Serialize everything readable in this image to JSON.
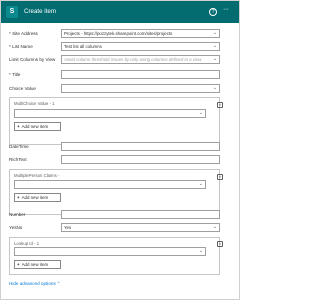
{
  "header": {
    "app_icon": "sharepoint-icon",
    "app_letter": "S",
    "title": "Create item",
    "help_glyph": "?",
    "more_glyph": "···"
  },
  "fields": {
    "site_address": {
      "label": "* Site Address",
      "value": "Projects - https://pozzytek.sharepoint.com/sites/projects"
    },
    "list_name": {
      "label": "* List Name",
      "value": "Test list all columns"
    },
    "limit_columns": {
      "label": "Limit Columns by View",
      "placeholder": "Avoid column threshold issues by only using columns defined in a view"
    },
    "title": {
      "label": "* Title",
      "value": ""
    },
    "choice_value": {
      "label": "Choice Value",
      "value": ""
    },
    "datetime": {
      "label": "DateTime",
      "value": ""
    },
    "richtext": {
      "label": "RichText",
      "value": ""
    },
    "number": {
      "label": "Number",
      "value": ""
    },
    "yesno": {
      "label": "YesNo",
      "value": "Yes"
    }
  },
  "groups": {
    "multichoice": {
      "label": "MultiChoice Value - 1",
      "add_label": "Add new item"
    },
    "multiperson": {
      "label": "MultiplePerson Claims -",
      "add_label": "Add new item"
    },
    "lookup": {
      "label": "Lookup Id - 1",
      "add_label": "Add new item"
    }
  },
  "footer": {
    "hide_advanced": "Hide advanced options"
  },
  "icons": {
    "chevron": "⌄",
    "plus": "+",
    "group_menu": "≡"
  }
}
